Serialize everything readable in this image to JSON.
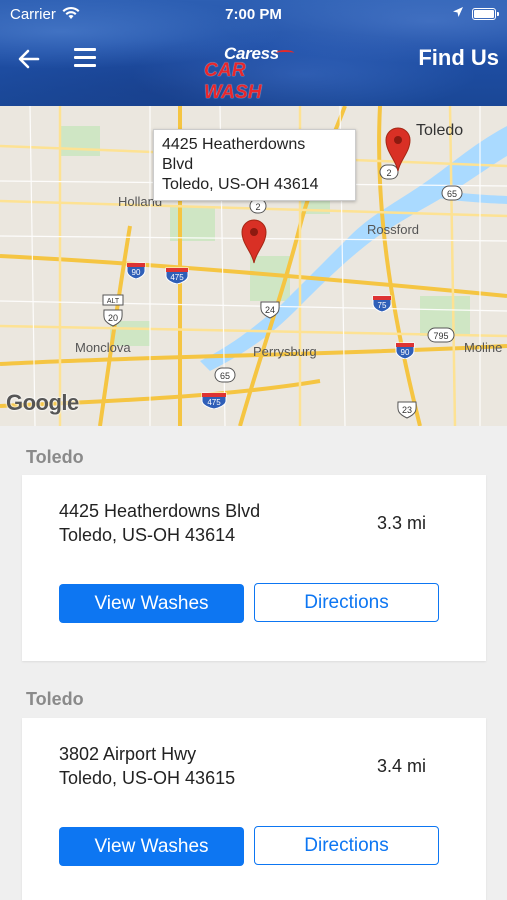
{
  "status_bar": {
    "carrier": "Carrier",
    "time": "7:00 PM"
  },
  "header": {
    "logo_top": "Caress",
    "logo_bottom": "CAR WASH",
    "find_us": "Find Us",
    "colors": {
      "bar": "#1f4fa6",
      "logo_red": "#e8262c"
    }
  },
  "map": {
    "callout_line1": "4425 Heatherdowns",
    "callout_line2": "Blvd",
    "callout_line3": "Toledo, US-OH  43614",
    "labels": {
      "toledo": "Toledo",
      "holland": "Holland",
      "rossford": "Rossford",
      "monclova": "Monclova",
      "perrysburg": "Perrysburg",
      "moline": "Moline"
    },
    "shields": {
      "i90a": "90",
      "i475a": "475",
      "us20": "20",
      "alt": "ALT",
      "us24": "24",
      "i75": "75",
      "r795": "795",
      "i90b": "90",
      "r65a": "65",
      "r65b": "65",
      "i475b": "475",
      "r23": "23",
      "r2a": "2",
      "r2b": "2"
    },
    "attribution": "Google"
  },
  "locations": [
    {
      "city": "Toledo",
      "address_line1": "4425 Heatherdowns Blvd",
      "address_line2": "Toledo, US-OH  43614",
      "distance": "3.3 mi",
      "view_label": "View Washes",
      "directions_label": "Directions"
    },
    {
      "city": "Toledo",
      "address_line1": "3802 Airport Hwy",
      "address_line2": "Toledo, US-OH  43615",
      "distance": "3.4 mi",
      "view_label": "View Washes",
      "directions_label": "Directions"
    }
  ],
  "colors": {
    "primary": "#0d76f2",
    "background": "#efefef",
    "pin": "#d93025"
  }
}
